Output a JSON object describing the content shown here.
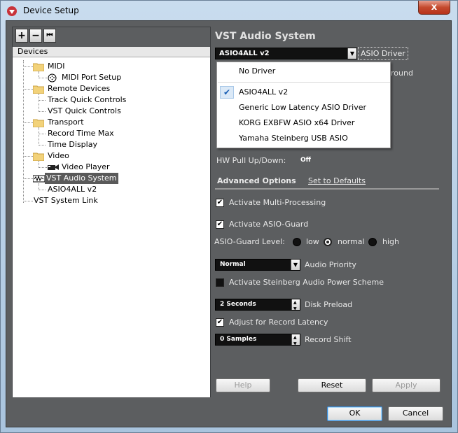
{
  "window": {
    "title": "Device Setup",
    "close_glyph": "x"
  },
  "toolbar": {
    "add_glyph": "+",
    "remove_glyph": "−",
    "reset_glyph": "⏮"
  },
  "devices": {
    "header": "Devices",
    "items": [
      {
        "label": "MIDI",
        "icon": "folder-icon"
      },
      {
        "label": "MIDI Port Setup",
        "icon": "midi-port-icon"
      },
      {
        "label": "Remote Devices",
        "icon": "folder-icon"
      },
      {
        "label": "Track Quick Controls"
      },
      {
        "label": "VST Quick Controls"
      },
      {
        "label": "Transport",
        "icon": "folder-icon"
      },
      {
        "label": "Record Time Max"
      },
      {
        "label": "Time Display"
      },
      {
        "label": "Video",
        "icon": "folder-icon"
      },
      {
        "label": "Video Player",
        "icon": "video-icon"
      },
      {
        "label": "VST Audio System",
        "icon": "audio-system-icon",
        "selected": true
      },
      {
        "label": "ASIO4ALL v2"
      },
      {
        "label": "VST System Link"
      }
    ]
  },
  "vst": {
    "title": "VST Audio System",
    "driver_value": "ASIO4ALL v2",
    "driver_label": "ASIO Driver",
    "behind_text": "round",
    "dropdown": [
      {
        "label": "No Driver",
        "checked": false
      },
      {
        "label": "ASIO4ALL v2",
        "checked": true
      },
      {
        "label": "Generic Low Latency ASIO Driver",
        "checked": false
      },
      {
        "label": "KORG EXBFW ASIO x64 Driver",
        "checked": false
      },
      {
        "label": "Yamaha Steinberg USB ASIO",
        "checked": false
      }
    ],
    "check_glyph": "✔",
    "hw_label": "HW Pull Up/Down:",
    "hw_value": "Off"
  },
  "advanced": {
    "tab_label": "Advanced Options",
    "defaults_label": "Set to Defaults",
    "multi_processing": {
      "label": "Activate Multi-Processing",
      "checked": true
    },
    "asio_guard": {
      "label": "Activate ASIO-Guard",
      "checked": true
    },
    "guard_level": {
      "label": "ASIO-Guard Level:",
      "options": [
        "low",
        "normal",
        "high"
      ],
      "selected": "normal"
    },
    "audio_priority": {
      "value": "Normal",
      "label": "Audio Priority"
    },
    "power_scheme": {
      "label": "Activate Steinberg Audio Power Scheme",
      "checked": false
    },
    "disk_preload": {
      "value": "2 Seconds",
      "label": "Disk Preload"
    },
    "record_latency": {
      "label": "Adjust for Record Latency",
      "checked": true
    },
    "record_shift": {
      "value": "0 Samples",
      "label": "Record Shift"
    }
  },
  "buttons": {
    "help": "Help",
    "reset": "Reset",
    "apply": "Apply",
    "ok": "OK",
    "cancel": "Cancel"
  },
  "colors": {
    "panel": "#5c5e60",
    "selection": "#5a5a5a",
    "accent": "#1a5fb4"
  }
}
